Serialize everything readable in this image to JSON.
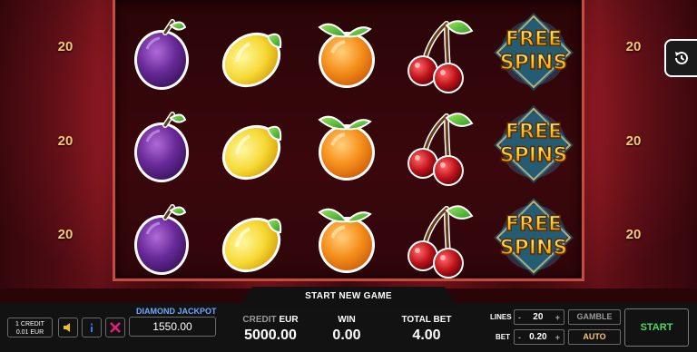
{
  "paylines": {
    "left": [
      "20",
      "20",
      "20"
    ],
    "right": [
      "20",
      "20",
      "20"
    ]
  },
  "reels": [
    [
      "plum",
      "lemon",
      "orange",
      "cherry",
      "free-spins"
    ],
    [
      "plum",
      "lemon",
      "orange",
      "cherry",
      "free-spins"
    ],
    [
      "plum",
      "lemon",
      "orange",
      "cherry",
      "free-spins"
    ]
  ],
  "free_spins_text": {
    "line1": "FREE",
    "line2": "SPINS"
  },
  "header": {
    "start_new_game": "START NEW GAME"
  },
  "credit_info": {
    "line1": "1 CREDIT",
    "line2": "0.01 EUR"
  },
  "jackpot": {
    "label": "DIAMOND JACKPOT",
    "value": "1550.00"
  },
  "stats": {
    "credit_label": "CREDIT",
    "currency": "EUR",
    "credit_value": "5000.00",
    "win_label": "WIN",
    "win_value": "0.00",
    "total_bet_label": "TOTAL BET",
    "total_bet_value": "4.00"
  },
  "controls": {
    "lines_label": "LINES",
    "lines_value": "20",
    "bet_label": "BET",
    "bet_value": "0.20",
    "minus": "-",
    "plus": "+",
    "gamble_label": "GAMBLE",
    "auto_label": "AUTO",
    "start_label": "START"
  },
  "colors": {
    "accent_gold": "#f5c874",
    "jackpot_blue": "#6fa8ff",
    "start_green": "#4cd964",
    "icon_yellow": "#f4c20d",
    "icon_blue": "#2b7de9",
    "icon_magenta": "#e0217a"
  },
  "icons": [
    "sound-icon",
    "info-icon",
    "paytable-icon",
    "history-icon"
  ]
}
